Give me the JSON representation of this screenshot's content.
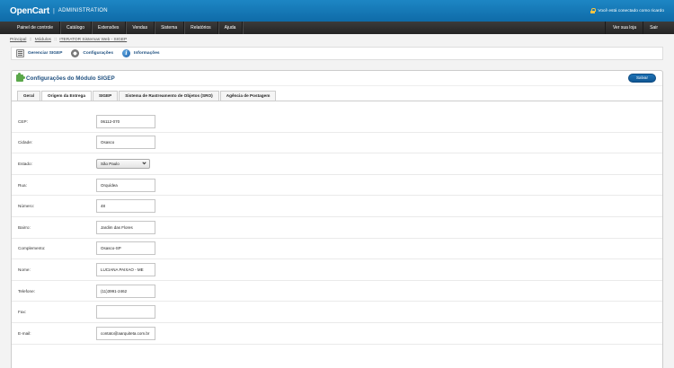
{
  "header": {
    "logo": "OpenCart",
    "separator": "|",
    "subtitle": "ADMINISTRATION",
    "login_status": "Você está conectado como ricardo"
  },
  "menu": {
    "items": [
      "Painel de controle",
      "Catálogo",
      "Extensões",
      "Vendas",
      "Sistema",
      "Relatórios",
      "Ajuda"
    ],
    "right": [
      "Ver sua loja",
      "Sair"
    ]
  },
  "breadcrumb": {
    "items": [
      "Principal",
      "Módulos",
      "ITERATOR Sistemas Web - SIGEP"
    ],
    "separator": "::"
  },
  "linkbar": {
    "manage": "Gerenciar SIGEP",
    "settings": "Configurações",
    "info": "Informações"
  },
  "panel": {
    "title": "Configurações do Módulo SIGEP",
    "save_label": "Salvar"
  },
  "tabs": [
    "Geral",
    "Origem da Entrega",
    "SIGEP",
    "Sistema de Rastreamento de Objetos (SRO)",
    "Agência de Postagem"
  ],
  "active_tab": "Origem da Entrega",
  "form": {
    "cep": {
      "label": "CEP:",
      "value": "06112-070"
    },
    "cidade": {
      "label": "Cidade:",
      "value": "Osasco"
    },
    "estado": {
      "label": "Estado:",
      "value": "São Paulo"
    },
    "rua": {
      "label": "Rua:",
      "value": "Orquídea"
    },
    "numero": {
      "label": "Número:",
      "value": "48"
    },
    "bairro": {
      "label": "Bairro:",
      "value": "Jardim das Flores"
    },
    "complemento": {
      "label": "Complemento:",
      "value": "Osasco-SP"
    },
    "nome": {
      "label": "Nome:",
      "value": "LUCIANA PAIXAO - ME"
    },
    "telefone": {
      "label": "Telefone:",
      "value": "(11)3991-2462"
    },
    "fax": {
      "label": "Fax:",
      "value": ""
    },
    "email": {
      "label": "E-mail:",
      "value": "contato@aarquiteta.com.br"
    }
  },
  "colors": {
    "header": "#0f6ba8",
    "menubar": "#242424",
    "accent_text": "#1e4f7f",
    "save_button": "#0f5693"
  }
}
